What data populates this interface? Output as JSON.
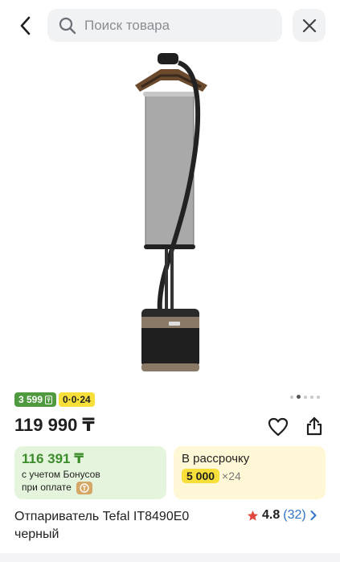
{
  "search": {
    "placeholder": "Поиск товара"
  },
  "badges": {
    "bonus": "3 599",
    "installment": "0·0·24"
  },
  "gallery": {
    "pages": 5,
    "active_page": 2
  },
  "price": "119 990 ₸",
  "bonus_card": {
    "amount": "116 391 ₸",
    "note_line1": "с учетом Бонусов",
    "note_line2": "при оплате"
  },
  "credit_card": {
    "label": "В рассрочку",
    "monthly": "5 000",
    "term": "×24"
  },
  "product": {
    "title": "Отпариватель Tefal IT8490E0 черный"
  },
  "rating": {
    "value": "4.8",
    "count": "(32)"
  },
  "colors": {
    "bonus_green": "#4f9a3f",
    "accent_yellow": "#f7df3a",
    "link_blue": "#2f74c6",
    "star_red": "#e0463a"
  }
}
